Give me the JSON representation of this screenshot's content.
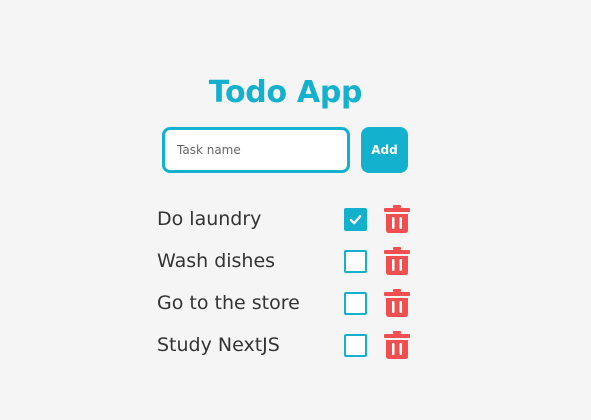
{
  "app": {
    "title": "Todo App"
  },
  "form": {
    "input_value": "",
    "input_placeholder": "Task name",
    "add_label": "Add"
  },
  "todos": [
    {
      "text": "Do laundry",
      "done": true
    },
    {
      "text": "Wash dishes",
      "done": false
    },
    {
      "text": "Go to the store",
      "done": false
    },
    {
      "text": "Study NextJS",
      "done": false
    }
  ],
  "colors": {
    "accent": "#14b1cf",
    "delete": "#f14f4f",
    "background": "#f5f5f5",
    "text": "#333333"
  },
  "icons": {
    "checkbox_checked": "check-icon",
    "delete": "trash-icon"
  }
}
